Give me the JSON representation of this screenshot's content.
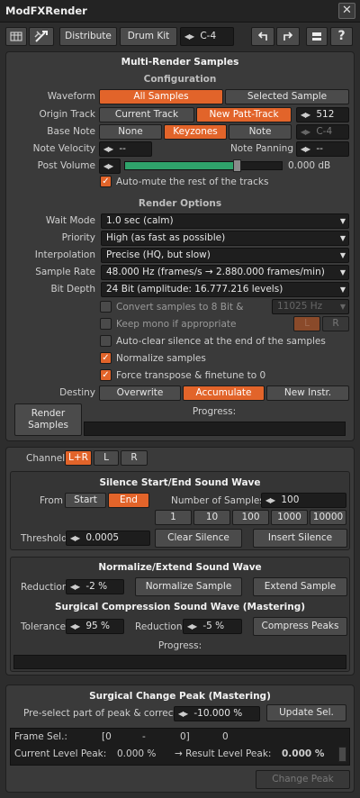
{
  "window": {
    "title": "ModFXRender",
    "close": "✕"
  },
  "toolbar": {
    "distribute": "Distribute",
    "drumkit": "Drum Kit",
    "note": "C-4"
  },
  "render_panel": {
    "title": "Multi-Render Samples",
    "config": "Configuration",
    "waveform": {
      "label": "Waveform",
      "all": "All Samples",
      "selected": "Selected Sample"
    },
    "origin": {
      "label": "Origin Track",
      "current": "Current Track",
      "new": "New Patt-Track",
      "value": "512"
    },
    "basenote": {
      "label": "Base Note",
      "none": "None",
      "keyzones": "Keyzones",
      "note": "Note",
      "value": "C-4"
    },
    "velocity": {
      "label": "Note Velocity",
      "value": "--",
      "panning_label": "Note Panning",
      "panning_value": "--"
    },
    "volume": {
      "label": "Post Volume",
      "value": "0.000 dB",
      "level": 0.71
    },
    "automute": "Auto-mute the rest of the tracks",
    "options": "Render Options",
    "wait": {
      "label": "Wait Mode",
      "value": "1.0 sec (calm)"
    },
    "priority": {
      "label": "Priority",
      "value": "High (as fast as possible)"
    },
    "interp": {
      "label": "Interpolation",
      "value": "Precise (HQ, but slow)"
    },
    "rate": {
      "label": "Sample Rate",
      "value": "48.000 Hz (frames/s → 2.880.000 frames/min)"
    },
    "depth": {
      "label": "Bit Depth",
      "value": "24 Bit (amplitude: 16.777.216 levels)"
    },
    "convert": {
      "label": "Convert samples to 8 Bit &",
      "value": "11025 Hz"
    },
    "mono": {
      "label": "Keep mono if appropriate",
      "l": "L",
      "r": "R"
    },
    "autoclear": "Auto-clear silence at the end of the samples",
    "normalize": "Normalize samples",
    "force": "Force transpose & finetune to 0",
    "destiny": {
      "label": "Destiny",
      "overwrite": "Overwrite",
      "accumulate": "Accumulate",
      "newinstr": "New Instr."
    },
    "render_btn": [
      "Render",
      "Samples"
    ],
    "progress": "Progress:"
  },
  "channel": {
    "label": "Channel",
    "lr": "L+R",
    "l": "L",
    "r": "R"
  },
  "silence": {
    "title": "Silence Start/End Sound Wave",
    "from": "From",
    "start": "Start",
    "end": "End",
    "nsamples_label": "Number of Samples",
    "nsamples": "100",
    "presets": [
      "1",
      "10",
      "100",
      "1000",
      "10000"
    ],
    "threshold_label": "Threshold",
    "threshold": "0.0005",
    "clear": "Clear Silence",
    "insert": "Insert Silence"
  },
  "normalize": {
    "title": "Normalize/Extend Sound Wave",
    "reduction_label": "Reduction",
    "reduction": "-2 %",
    "norm_btn": "Normalize Sample",
    "extend_btn": "Extend Sample"
  },
  "compress": {
    "title": "Surgical Compression Sound Wave (Mastering)",
    "tol_label": "Tolerance",
    "tol": "95 %",
    "red_label": "Reduction",
    "red": "-5 %",
    "btn": "Compress Peaks",
    "progress": "Progress:"
  },
  "peak": {
    "title": "Surgical Change Peak (Mastering)",
    "preselect": "Pre-select part of peak & correct:",
    "value": "-10.000 %",
    "update": "Update Sel.",
    "frame_label": "Frame Sel.:",
    "frame_a": "[0",
    "frame_dash": "-",
    "frame_b": "0]",
    "frame_c": "0",
    "cur_label": "Current Level Peak:",
    "cur": "0.000 %",
    "res_label": "→ Result Level Peak:",
    "res": "0.000 %",
    "change": "Change Peak"
  }
}
